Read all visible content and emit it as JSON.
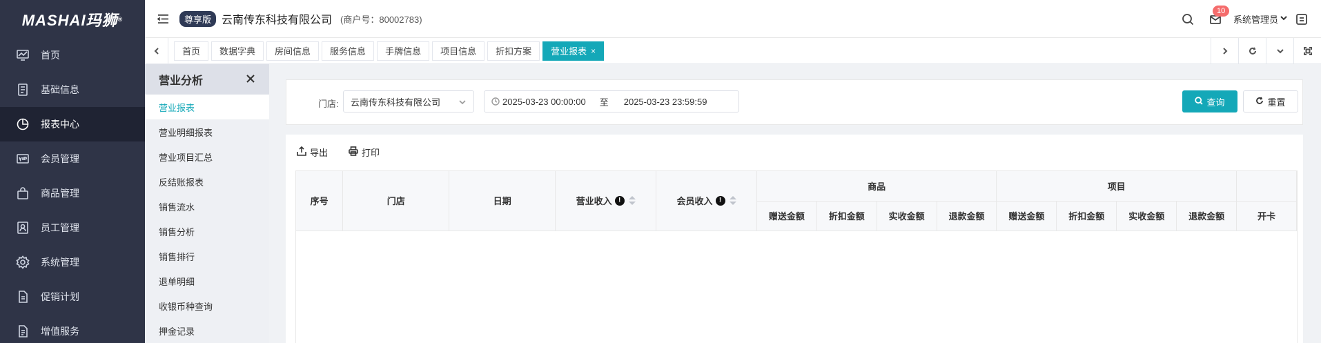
{
  "brand": {
    "logo_text": "MASHAI玛狮",
    "logo_mark": "®"
  },
  "nav": {
    "items": [
      {
        "label": "首页",
        "icon": "dashboard-icon",
        "active": false
      },
      {
        "label": "基础信息",
        "icon": "document-icon",
        "active": false
      },
      {
        "label": "报表中心",
        "icon": "pie-chart-icon",
        "active": true
      },
      {
        "label": "会员管理",
        "icon": "vip-card-icon",
        "active": false
      },
      {
        "label": "商品管理",
        "icon": "shopping-bag-icon",
        "active": false
      },
      {
        "label": "员工管理",
        "icon": "employee-badge-icon",
        "active": false
      },
      {
        "label": "系统管理",
        "icon": "gear-icon",
        "active": false
      },
      {
        "label": "促销计划",
        "icon": "file-icon",
        "active": false
      },
      {
        "label": "增值服务",
        "icon": "file-list-icon",
        "active": false
      }
    ]
  },
  "header": {
    "edition": "尊享版",
    "company": "云南传东科技有限公司",
    "merchant": "(商户号：80002783)",
    "message_count": "10",
    "user": "系统管理员"
  },
  "tabs": [
    {
      "label": "首页",
      "active": false
    },
    {
      "label": "数据字典",
      "active": false
    },
    {
      "label": "房间信息",
      "active": false
    },
    {
      "label": "服务信息",
      "active": false
    },
    {
      "label": "手牌信息",
      "active": false
    },
    {
      "label": "项目信息",
      "active": false
    },
    {
      "label": "折扣方案",
      "active": false
    },
    {
      "label": "营业报表",
      "active": true,
      "close": "×"
    }
  ],
  "subnav": {
    "title": "营业分析",
    "items": [
      {
        "label": "营业报表",
        "active": true
      },
      {
        "label": "营业明细报表",
        "active": false
      },
      {
        "label": "营业项目汇总",
        "active": false
      },
      {
        "label": "反结账报表",
        "active": false
      },
      {
        "label": "销售流水",
        "active": false
      },
      {
        "label": "销售分析",
        "active": false
      },
      {
        "label": "销售排行",
        "active": false
      },
      {
        "label": "退单明细",
        "active": false
      },
      {
        "label": "收银币种查询",
        "active": false
      },
      {
        "label": "押金记录",
        "active": false
      }
    ]
  },
  "filter": {
    "store_label": "门店:",
    "store_value": "云南传东科技有限公司",
    "date_start": "2025-03-23 00:00:00",
    "date_sep": "至",
    "date_end": "2025-03-23 23:59:59",
    "query_label": "查询",
    "reset_label": "重置"
  },
  "toolbar": {
    "export_label": "导出",
    "print_label": "打印"
  },
  "table": {
    "headers": {
      "seq": "序号",
      "store": "门店",
      "date": "日期",
      "revenue": "营业收入",
      "member_income": "会员收入",
      "info_mark": "!",
      "group_goods": "商品",
      "group_items": "项目",
      "goods_gift": "赠送金额",
      "goods_discount": "折扣金额",
      "goods_received": "实收金额",
      "goods_refund": "退款金额",
      "items_gift": "赠送金额",
      "items_discount": "折扣金额",
      "items_received": "实收金额",
      "items_refund": "退款金额",
      "open_card": "开卡"
    }
  },
  "colors": {
    "accent": "#14a8b8",
    "nav_bg": "#2f3447",
    "nav_active_bg": "#1f2333"
  }
}
